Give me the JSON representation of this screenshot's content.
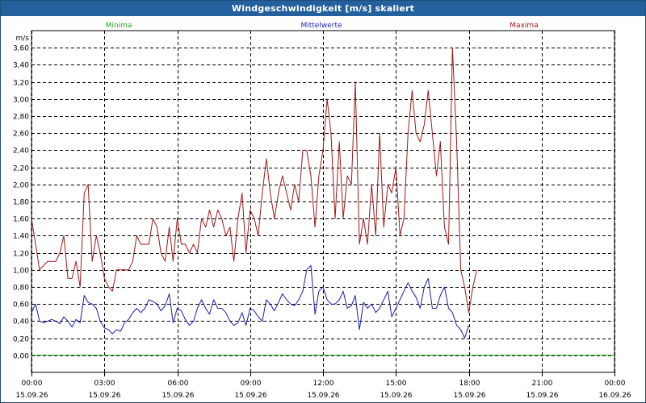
{
  "window": {
    "title": "Windgeschwindigkeit [m/s] skaliert"
  },
  "chart_data": {
    "type": "line",
    "title": "Windgeschwindigkeit [m/s] skaliert",
    "ylabel": "m/s",
    "ylim": [
      -0.2,
      3.8
    ],
    "yticks": [
      "0,00",
      "0,20",
      "0,40",
      "0,60",
      "0,80",
      "1,00",
      "1,20",
      "1,40",
      "1,60",
      "1,80",
      "2,00",
      "2,20",
      "2,40",
      "2,60",
      "2,80",
      "3,00",
      "3,20",
      "3,40",
      "3,60"
    ],
    "xlim": [
      0,
      24
    ],
    "xticks": [
      {
        "time": "00:00",
        "date": "15.09.26"
      },
      {
        "time": "03:00",
        "date": "15.09.26"
      },
      {
        "time": "06:00",
        "date": "15.09.26"
      },
      {
        "time": "09:00",
        "date": "15.09.26"
      },
      {
        "time": "12:00",
        "date": "15.09.26"
      },
      {
        "time": "15:00",
        "date": "15.09.26"
      },
      {
        "time": "18:00",
        "date": "15.09.26"
      },
      {
        "time": "21:00",
        "date": "15.09.26"
      },
      {
        "time": "00:00",
        "date": "16.09.26"
      }
    ],
    "grid": true,
    "legend_position": "top",
    "series": [
      {
        "name": "Minima",
        "color": "#22aa22",
        "points": [
          [
            0,
            0
          ],
          [
            18,
            0
          ],
          [
            24,
            0
          ]
        ]
      },
      {
        "name": "Mittelwerte",
        "color": "#1c1cb4",
        "points": [
          [
            0,
            0.5
          ],
          [
            0.17,
            0.6
          ],
          [
            0.33,
            0.4
          ],
          [
            0.5,
            0.38
          ],
          [
            0.67,
            0.4
          ],
          [
            0.83,
            0.42
          ],
          [
            1,
            0.4
          ],
          [
            1.17,
            0.37
          ],
          [
            1.33,
            0.45
          ],
          [
            1.5,
            0.4
          ],
          [
            1.67,
            0.33
          ],
          [
            1.83,
            0.42
          ],
          [
            2,
            0.38
          ],
          [
            2.17,
            0.7
          ],
          [
            2.33,
            0.62
          ],
          [
            2.5,
            0.6
          ],
          [
            2.67,
            0.55
          ],
          [
            2.83,
            0.4
          ],
          [
            3,
            0.32
          ],
          [
            3.17,
            0.3
          ],
          [
            3.33,
            0.25
          ],
          [
            3.5,
            0.3
          ],
          [
            3.67,
            0.28
          ],
          [
            3.83,
            0.38
          ],
          [
            4,
            0.42
          ],
          [
            4.17,
            0.5
          ],
          [
            4.33,
            0.55
          ],
          [
            4.5,
            0.5
          ],
          [
            4.67,
            0.55
          ],
          [
            4.83,
            0.65
          ],
          [
            5,
            0.63
          ],
          [
            5.17,
            0.6
          ],
          [
            5.33,
            0.52
          ],
          [
            5.5,
            0.58
          ],
          [
            5.67,
            0.72
          ],
          [
            5.83,
            0.38
          ],
          [
            6,
            0.55
          ],
          [
            6.17,
            0.52
          ],
          [
            6.33,
            0.42
          ],
          [
            6.5,
            0.35
          ],
          [
            6.67,
            0.4
          ],
          [
            6.83,
            0.55
          ],
          [
            7,
            0.65
          ],
          [
            7.17,
            0.55
          ],
          [
            7.33,
            0.48
          ],
          [
            7.5,
            0.65
          ],
          [
            7.67,
            0.55
          ],
          [
            7.83,
            0.55
          ],
          [
            8,
            0.5
          ],
          [
            8.17,
            0.4
          ],
          [
            8.33,
            0.35
          ],
          [
            8.5,
            0.38
          ],
          [
            8.67,
            0.5
          ],
          [
            8.83,
            0.35
          ],
          [
            9,
            0.55
          ],
          [
            9.17,
            0.52
          ],
          [
            9.33,
            0.45
          ],
          [
            9.5,
            0.4
          ],
          [
            9.67,
            0.65
          ],
          [
            9.83,
            0.6
          ],
          [
            10,
            0.52
          ],
          [
            10.17,
            0.62
          ],
          [
            10.33,
            0.72
          ],
          [
            10.5,
            0.65
          ],
          [
            10.67,
            0.6
          ],
          [
            10.83,
            0.58
          ],
          [
            11,
            0.65
          ],
          [
            11.17,
            0.75
          ],
          [
            11.33,
            1.0
          ],
          [
            11.5,
            1.05
          ],
          [
            11.67,
            0.48
          ],
          [
            11.83,
            0.75
          ],
          [
            12,
            0.8
          ],
          [
            12.17,
            0.65
          ],
          [
            12.33,
            0.6
          ],
          [
            12.5,
            0.6
          ],
          [
            12.67,
            0.65
          ],
          [
            12.83,
            0.75
          ],
          [
            13,
            0.55
          ],
          [
            13.17,
            0.58
          ],
          [
            13.33,
            0.7
          ],
          [
            13.5,
            0.3
          ],
          [
            13.67,
            0.62
          ],
          [
            13.83,
            0.55
          ],
          [
            14,
            0.6
          ],
          [
            14.17,
            0.5
          ],
          [
            14.33,
            0.55
          ],
          [
            14.5,
            0.65
          ],
          [
            14.67,
            0.75
          ],
          [
            14.83,
            0.45
          ],
          [
            15,
            0.55
          ],
          [
            15.17,
            0.65
          ],
          [
            15.33,
            0.75
          ],
          [
            15.5,
            0.85
          ],
          [
            15.67,
            0.75
          ],
          [
            15.83,
            0.68
          ],
          [
            16,
            0.55
          ],
          [
            16.17,
            0.8
          ],
          [
            16.33,
            0.9
          ],
          [
            16.5,
            0.55
          ],
          [
            16.67,
            0.55
          ],
          [
            16.83,
            0.7
          ],
          [
            17,
            0.8
          ],
          [
            17.17,
            0.55
          ],
          [
            17.33,
            0.5
          ],
          [
            17.5,
            0.35
          ],
          [
            17.67,
            0.3
          ],
          [
            17.83,
            0.2
          ],
          [
            18,
            0.35
          ]
        ]
      },
      {
        "name": "Maxima",
        "color": "#a01818",
        "points": [
          [
            0,
            1.6
          ],
          [
            0.17,
            1.3
          ],
          [
            0.33,
            1.0
          ],
          [
            0.5,
            1.05
          ],
          [
            0.67,
            1.1
          ],
          [
            0.83,
            1.1
          ],
          [
            1,
            1.1
          ],
          [
            1.17,
            1.2
          ],
          [
            1.33,
            1.4
          ],
          [
            1.5,
            0.9
          ],
          [
            1.67,
            0.9
          ],
          [
            1.83,
            1.1
          ],
          [
            2,
            0.8
          ],
          [
            2.17,
            1.9
          ],
          [
            2.33,
            2.0
          ],
          [
            2.5,
            1.1
          ],
          [
            2.67,
            1.4
          ],
          [
            2.83,
            1.2
          ],
          [
            3,
            0.9
          ],
          [
            3.17,
            0.8
          ],
          [
            3.33,
            0.75
          ],
          [
            3.5,
            1.0
          ],
          [
            3.67,
            1.0
          ],
          [
            3.83,
            1.0
          ],
          [
            4,
            1.0
          ],
          [
            4.17,
            1.1
          ],
          [
            4.33,
            1.4
          ],
          [
            4.5,
            1.3
          ],
          [
            4.67,
            1.3
          ],
          [
            4.83,
            1.3
          ],
          [
            5,
            1.6
          ],
          [
            5.17,
            1.5
          ],
          [
            5.33,
            1.2
          ],
          [
            5.5,
            1.1
          ],
          [
            5.67,
            1.5
          ],
          [
            5.83,
            1.1
          ],
          [
            6,
            1.6
          ],
          [
            6.17,
            1.3
          ],
          [
            6.33,
            1.3
          ],
          [
            6.5,
            1.2
          ],
          [
            6.67,
            1.3
          ],
          [
            6.83,
            1.2
          ],
          [
            7,
            1.6
          ],
          [
            7.17,
            1.5
          ],
          [
            7.33,
            1.7
          ],
          [
            7.5,
            1.5
          ],
          [
            7.67,
            1.7
          ],
          [
            7.83,
            1.6
          ],
          [
            8,
            1.4
          ],
          [
            8.17,
            1.5
          ],
          [
            8.33,
            1.1
          ],
          [
            8.5,
            1.6
          ],
          [
            8.67,
            1.9
          ],
          [
            8.83,
            1.2
          ],
          [
            9,
            1.7
          ],
          [
            9.17,
            1.6
          ],
          [
            9.33,
            1.4
          ],
          [
            9.5,
            1.9
          ],
          [
            9.67,
            2.3
          ],
          [
            9.83,
            1.9
          ],
          [
            10,
            1.6
          ],
          [
            10.17,
            1.9
          ],
          [
            10.33,
            2.1
          ],
          [
            10.5,
            1.9
          ],
          [
            10.67,
            1.7
          ],
          [
            10.83,
            2.0
          ],
          [
            11,
            1.8
          ],
          [
            11.17,
            2.4
          ],
          [
            11.33,
            2.4
          ],
          [
            11.5,
            2.1
          ],
          [
            11.67,
            1.5
          ],
          [
            11.83,
            2.1
          ],
          [
            12,
            2.4
          ],
          [
            12.17,
            3.0
          ],
          [
            12.33,
            2.6
          ],
          [
            12.5,
            1.6
          ],
          [
            12.67,
            2.5
          ],
          [
            12.83,
            1.6
          ],
          [
            13,
            2.1
          ],
          [
            13.17,
            2.0
          ],
          [
            13.33,
            3.2
          ],
          [
            13.5,
            1.3
          ],
          [
            13.67,
            1.6
          ],
          [
            13.83,
            1.3
          ],
          [
            14,
            2.0
          ],
          [
            14.17,
            1.4
          ],
          [
            14.33,
            2.6
          ],
          [
            14.5,
            1.5
          ],
          [
            14.67,
            2.0
          ],
          [
            14.83,
            1.9
          ],
          [
            15,
            2.2
          ],
          [
            15.17,
            1.4
          ],
          [
            15.33,
            1.6
          ],
          [
            15.5,
            2.6
          ],
          [
            15.67,
            3.1
          ],
          [
            15.83,
            2.6
          ],
          [
            16,
            2.5
          ],
          [
            16.17,
            2.7
          ],
          [
            16.33,
            3.1
          ],
          [
            16.5,
            2.6
          ],
          [
            16.67,
            2.1
          ],
          [
            16.83,
            2.5
          ],
          [
            17,
            1.5
          ],
          [
            17.17,
            1.3
          ],
          [
            17.33,
            3.6
          ],
          [
            17.5,
            2.5
          ],
          [
            17.67,
            1.0
          ],
          [
            17.83,
            0.8
          ],
          [
            18,
            0.5
          ],
          [
            18.17,
            0.8
          ],
          [
            18.33,
            1.0
          ]
        ]
      }
    ]
  }
}
